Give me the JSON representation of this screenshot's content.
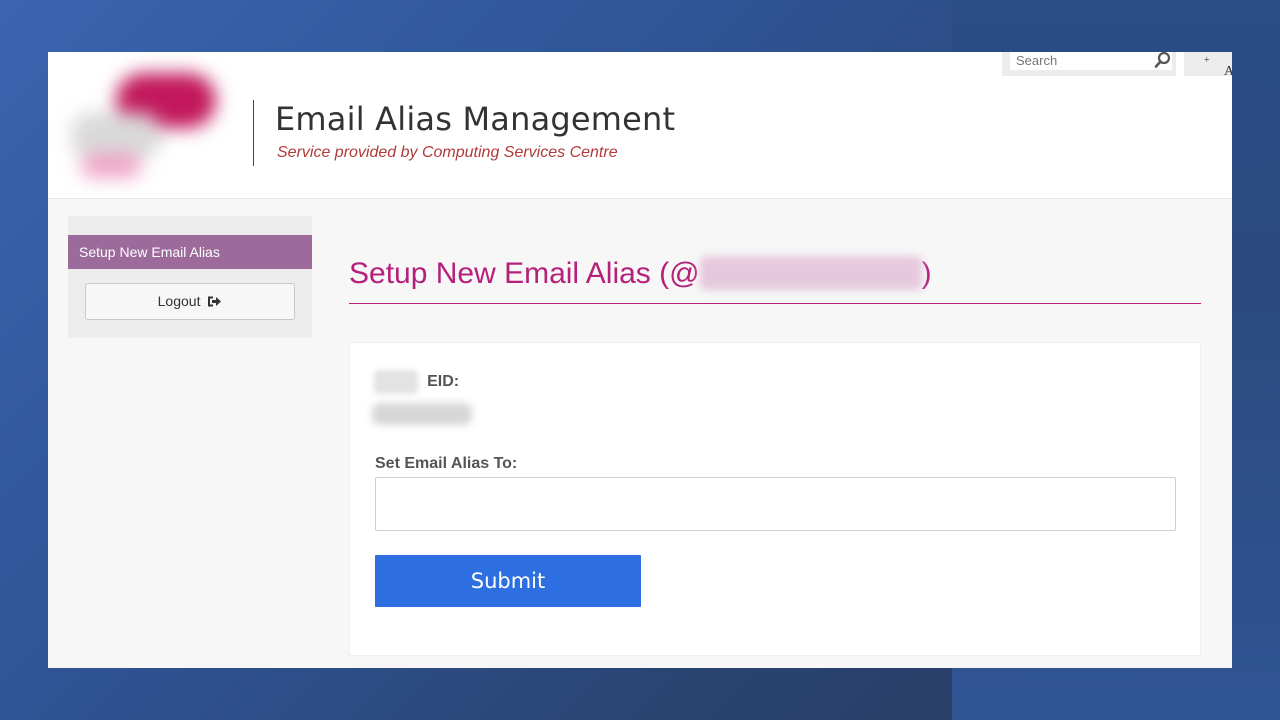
{
  "header": {
    "title": "Email Alias Management",
    "subtitle": "Service provided by Computing Services Centre"
  },
  "search": {
    "placeholder": "Search"
  },
  "font_size_control": {
    "label": "A",
    "suffix": "+"
  },
  "sidebar": {
    "items": [
      {
        "label": "Setup New Email Alias",
        "active": true
      }
    ],
    "logout_label": "Logout"
  },
  "main": {
    "heading_prefix": "Setup New Email Alias (@",
    "heading_suffix": ")",
    "eid_label": "EID:",
    "alias_label": "Set Email Alias To:",
    "alias_value": "",
    "submit_label": "Submit"
  },
  "colors": {
    "accent_magenta": "#b5207a",
    "sidebar_active": "#9c6b9c",
    "submit_blue": "#2d6ee0",
    "subtitle_red": "#b23a3a"
  },
  "icons": {
    "search": "search-icon",
    "logout": "sign-out-icon"
  }
}
